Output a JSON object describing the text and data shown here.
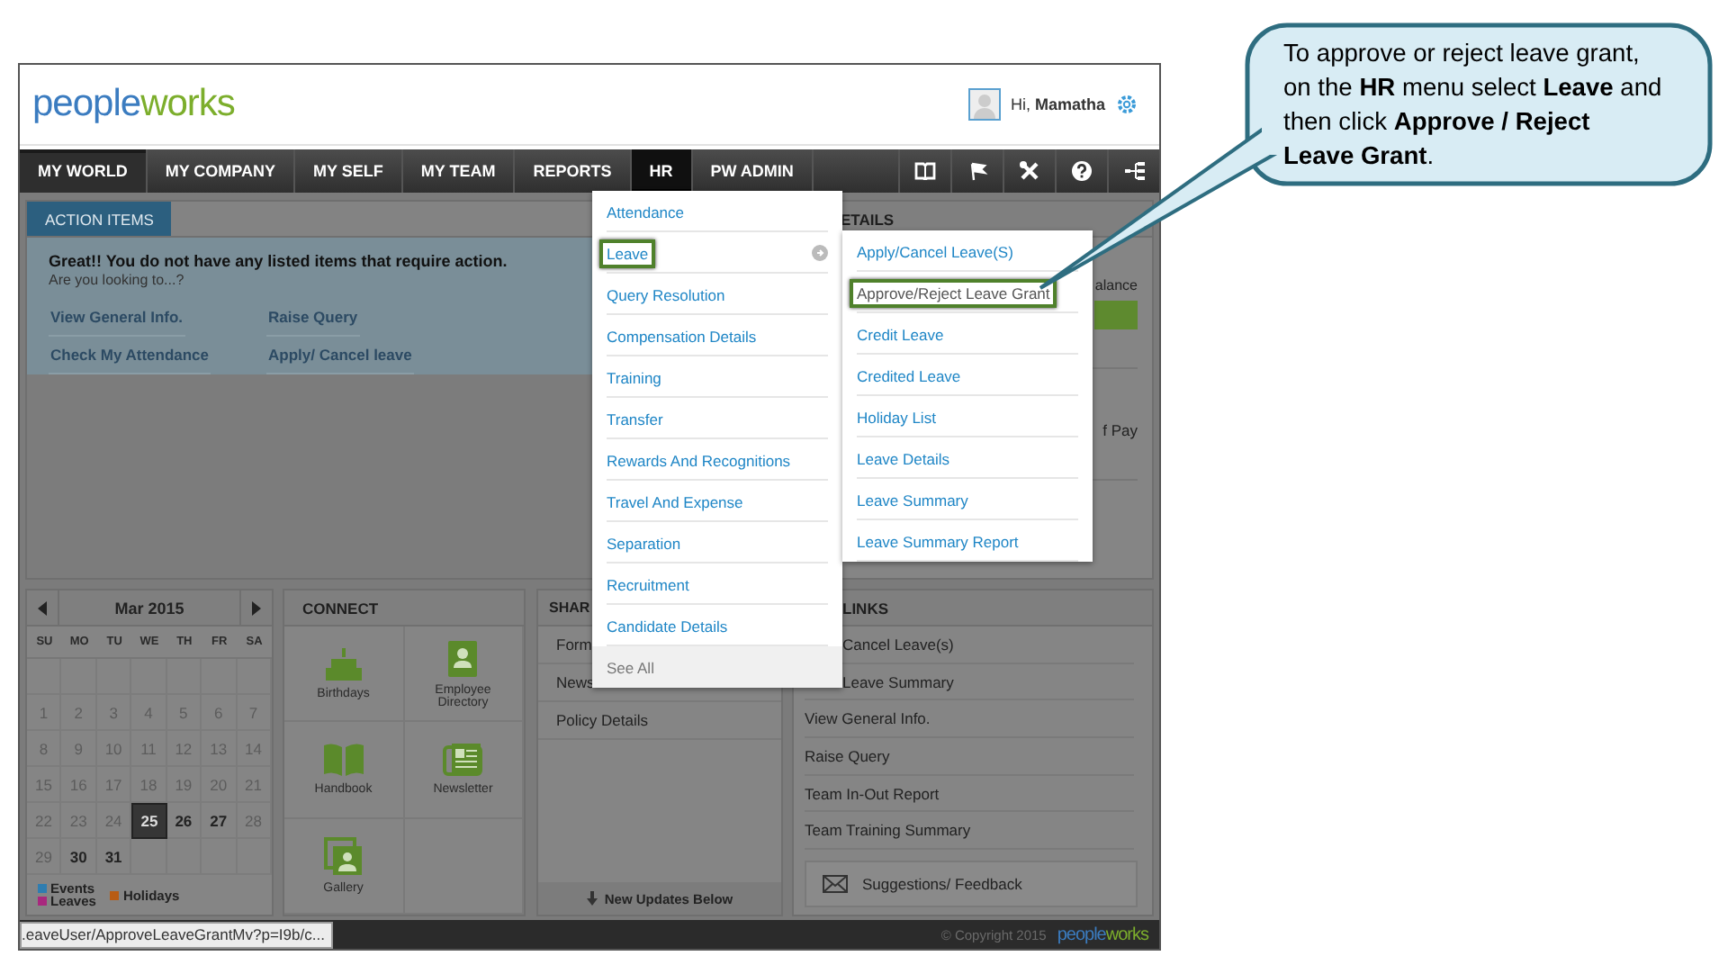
{
  "callout": {
    "text": "To approve or reject leave grant, on the **HR** menu select **Leave** and then click **Approve / Reject Leave Grant**."
  },
  "header": {
    "logo": {
      "part_1": "people",
      "part_2": "works"
    },
    "greeting": "Hi, **Mamatha**"
  },
  "nav": {
    "items": [
      {
        "label": "MY WORLD",
        "selected": true,
        "open": false
      },
      {
        "label": "MY COMPANY",
        "selected": false,
        "open": false
      },
      {
        "label": "MY SELF",
        "selected": false,
        "open": false
      },
      {
        "label": "MY TEAM",
        "selected": false,
        "open": false
      },
      {
        "label": "REPORTS",
        "selected": false,
        "open": false
      },
      {
        "label": "HR",
        "selected": false,
        "open": true
      },
      {
        "label": "PW ADMIN",
        "selected": false,
        "open": false
      }
    ]
  },
  "action_items": {
    "tab": "ACTION ITEMS",
    "message": "Great!! You do not have any listed items that require action.",
    "prompt": "Are you looking to...?",
    "links": [
      "View General Info.",
      "Raise Query",
      "Check My Attendance",
      "Apply/ Cancel leave"
    ]
  },
  "details_panel": {
    "title": "ETAILS",
    "balance_label": "alance",
    "pay_label": "f Pay"
  },
  "calendar": {
    "month": "Mar 2015",
    "weekdays": [
      "SU",
      "MO",
      "TU",
      "WE",
      "TH",
      "FR",
      "SA"
    ],
    "days": [
      {
        "day": "1",
        "selected": false,
        "past": true
      },
      {
        "day": "2",
        "selected": false,
        "past": true
      },
      {
        "day": "3",
        "selected": false,
        "past": true
      },
      {
        "day": "4",
        "selected": false,
        "past": true
      },
      {
        "day": "5",
        "selected": false,
        "past": true
      },
      {
        "day": "6",
        "selected": false,
        "past": true
      },
      {
        "day": "7",
        "selected": false,
        "past": true
      },
      {
        "day": "8",
        "selected": false,
        "past": true
      },
      {
        "day": "9",
        "selected": false,
        "past": true
      },
      {
        "day": "10",
        "selected": false,
        "past": true
      },
      {
        "day": "11",
        "selected": false,
        "past": true
      },
      {
        "day": "12",
        "selected": false,
        "past": true
      },
      {
        "day": "13",
        "selected": false,
        "past": true
      },
      {
        "day": "14",
        "selected": false,
        "past": true
      },
      {
        "day": "15",
        "selected": false,
        "past": true
      },
      {
        "day": "16",
        "selected": false,
        "past": true
      },
      {
        "day": "17",
        "selected": false,
        "past": true
      },
      {
        "day": "18",
        "selected": false,
        "past": true
      },
      {
        "day": "19",
        "selected": false,
        "past": true
      },
      {
        "day": "20",
        "selected": false,
        "past": true
      },
      {
        "day": "21",
        "selected": false,
        "past": true
      },
      {
        "day": "22",
        "selected": false,
        "past": true
      },
      {
        "day": "23",
        "selected": false,
        "past": true
      },
      {
        "day": "24",
        "selected": false,
        "past": true
      },
      {
        "day": "25",
        "selected": true,
        "past": false
      },
      {
        "day": "26",
        "selected": false,
        "past": false
      },
      {
        "day": "27",
        "selected": false,
        "past": false
      },
      {
        "day": "28",
        "selected": false,
        "past": true
      },
      {
        "day": "29",
        "selected": false,
        "past": true
      },
      {
        "day": "30",
        "selected": false,
        "past": false
      },
      {
        "day": "31",
        "selected": false,
        "past": false
      }
    ],
    "legend": [
      {
        "label": "Events",
        "color": "#2f7db0"
      },
      {
        "label": "Leaves",
        "color": "#a8287e"
      },
      {
        "label": "Holidays",
        "color": "#b85c14"
      }
    ]
  },
  "connect": {
    "title": "CONNECT",
    "tiles": [
      {
        "label": "Birthdays",
        "kind": "cake"
      },
      {
        "label": "Employee Directory",
        "kind": "directory"
      },
      {
        "label": "Handbook",
        "kind": "book"
      },
      {
        "label": "Newsletter",
        "kind": "newsletter"
      },
      {
        "label": "Gallery",
        "kind": "gallery"
      }
    ]
  },
  "shared_panel": {
    "title": "SHAR",
    "items": [
      "Form",
      "News",
      "Policy Details"
    ],
    "footer": "New Updates Below"
  },
  "links_panel": {
    "title": "LINKS",
    "items": [
      "Cancel Leave(s)",
      "Leave Summary",
      "View General Info.",
      "Raise Query",
      "Team In-Out Report",
      "Team Training Summary"
    ],
    "feedback": "Suggestions/ Feedback"
  },
  "hr_menu": {
    "items": [
      {
        "label": "Attendance",
        "highlighted": false,
        "has_submenu": false
      },
      {
        "label": "Leave",
        "highlighted": true,
        "has_submenu": true
      },
      {
        "label": "Query Resolution",
        "highlighted": false,
        "has_submenu": false
      },
      {
        "label": "Compensation Details",
        "highlighted": false,
        "has_submenu": false
      },
      {
        "label": "Training",
        "highlighted": false,
        "has_submenu": false
      },
      {
        "label": "Transfer",
        "highlighted": false,
        "has_submenu": false
      },
      {
        "label": "Rewards And Recognitions",
        "highlighted": false,
        "has_submenu": false
      },
      {
        "label": "Travel And Expense",
        "highlighted": false,
        "has_submenu": false
      },
      {
        "label": "Separation",
        "highlighted": false,
        "has_submenu": false
      },
      {
        "label": "Recruitment",
        "highlighted": false,
        "has_submenu": false
      },
      {
        "label": "Candidate Details",
        "highlighted": false,
        "has_submenu": false
      }
    ],
    "see_all": "See All"
  },
  "leave_submenu": {
    "items": [
      {
        "label": "Apply/Cancel Leave(S)",
        "highlighted": false
      },
      {
        "label": "Approve/Reject Leave Grant",
        "highlighted": true
      },
      {
        "label": "Credit Leave",
        "highlighted": false
      },
      {
        "label": "Credited Leave",
        "highlighted": false
      },
      {
        "label": "Holiday List",
        "highlighted": false
      },
      {
        "label": "Leave Details",
        "highlighted": false
      },
      {
        "label": "Leave Summary",
        "highlighted": false
      },
      {
        "label": "Leave Summary Report",
        "highlighted": false
      }
    ]
  },
  "status_bar": {
    "url": ".eaveUser/ApproveLeaveGrantMv?p=I9b/c...",
    "copyright": "© Copyright 2015",
    "logo": {
      "part_1": "people",
      "part_2": "works"
    }
  }
}
